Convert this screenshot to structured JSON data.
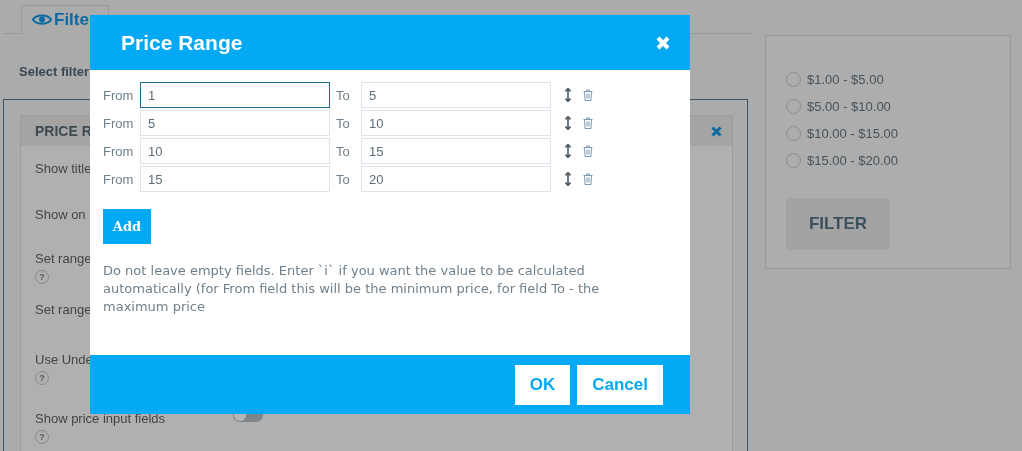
{
  "background": {
    "tabs": [
      {
        "label": "Filte",
        "selected": true
      }
    ],
    "select_label": "Select filter",
    "panel": {
      "title": "PRICE R",
      "settings": [
        {
          "label": "Show title"
        },
        {
          "label": "Show on"
        },
        {
          "label": "Set range",
          "help": "?"
        },
        {
          "label": "Set range"
        },
        {
          "label": "Use Unde",
          "help": "?"
        },
        {
          "label": "Show price input fields",
          "help": "?",
          "toggle": {
            "on": false
          }
        }
      ]
    },
    "preview": {
      "options": [
        {
          "label": "$1.00 - $5.00",
          "selected": false
        },
        {
          "label": "$5.00 - $10.00",
          "selected": false
        },
        {
          "label": "$10.00 - $15.00",
          "selected": false
        },
        {
          "label": "$15.00 - $20.00",
          "selected": false
        }
      ],
      "button": "FILTER"
    }
  },
  "dialog": {
    "title": "Price Range",
    "ranges": [
      {
        "from_label": "From",
        "from": "1",
        "to_label": "To",
        "to": "5",
        "focused": true
      },
      {
        "from_label": "From",
        "from": "5",
        "to_label": "To",
        "to": "10",
        "focused": false
      },
      {
        "from_label": "From",
        "from": "10",
        "to_label": "To",
        "to": "15",
        "focused": false
      },
      {
        "from_label": "From",
        "from": "15",
        "to_label": "To",
        "to": "20",
        "focused": false
      }
    ],
    "add_button": "Add",
    "note": "Do not leave empty fields. Enter `i` if you want the value to be calculated automatically (for From field this will be the minimum price, for field To - the maximum price",
    "buttons": [
      "OK",
      "Cancel"
    ]
  }
}
